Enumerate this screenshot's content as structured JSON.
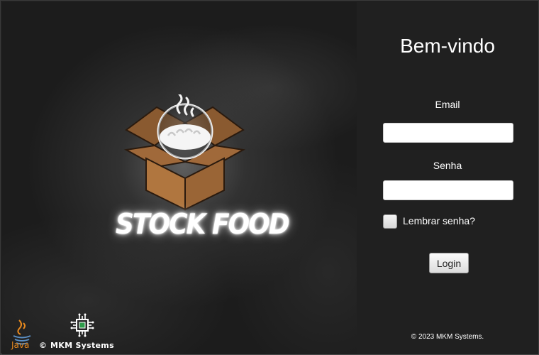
{
  "brand": {
    "name": "STOCK FOOD",
    "java_label": "Java",
    "copyright_symbol": "©",
    "company_label": "MKM Systems"
  },
  "login": {
    "title": "Bem-vindo",
    "email_label": "Email",
    "email_value": "",
    "password_label": "Senha",
    "password_value": "",
    "remember_label": "Lembrar senha?",
    "remember_checked": false,
    "login_button": "Login",
    "footer": "© 2023 MKM Systems."
  },
  "colors": {
    "panel_dark": "#202020",
    "box_brown": "#a0693a",
    "java_orange": "#e8891e"
  },
  "icons": {
    "logo": "food-box-icon",
    "java": "java-cup-icon",
    "company": "mkm-chip-icon"
  }
}
